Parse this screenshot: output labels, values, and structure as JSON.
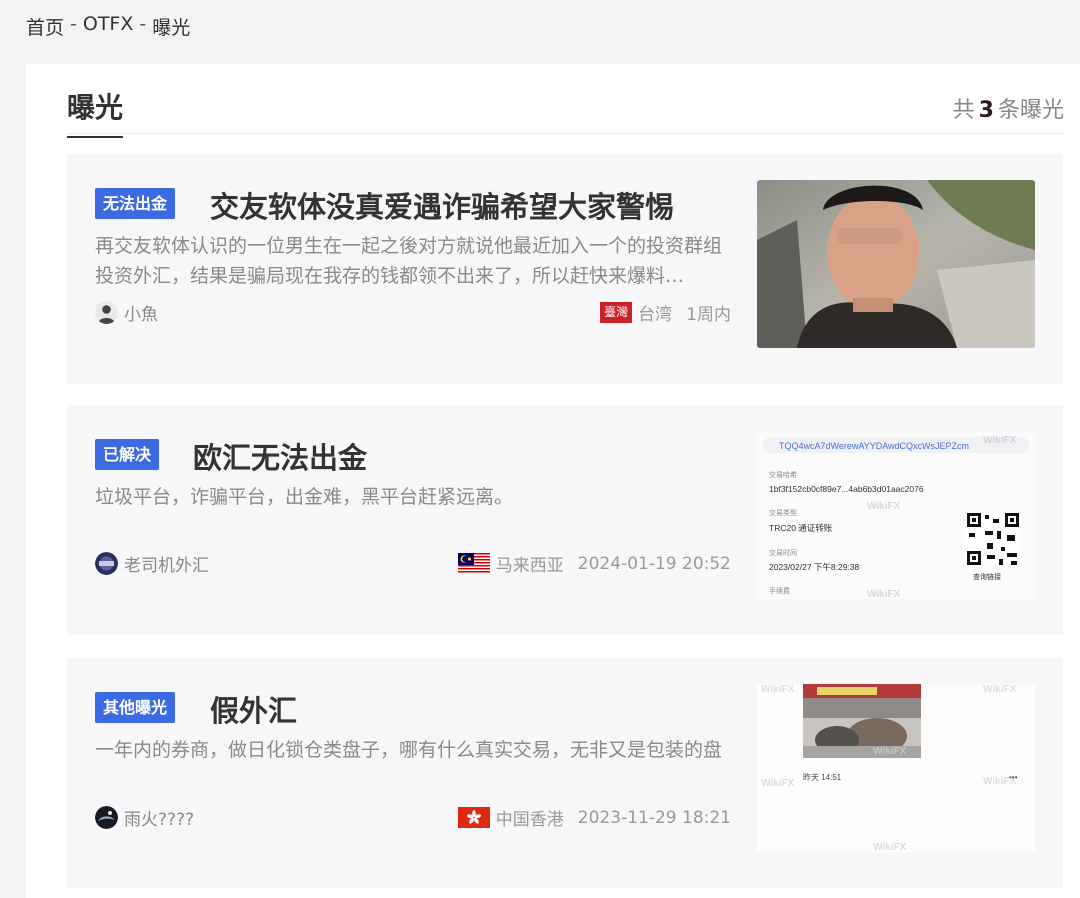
{
  "breadcrumb": {
    "home": "首页",
    "broker": "OTFX",
    "current": "曝光",
    "separator": "-"
  },
  "header": {
    "title": "曝光",
    "count_prefix": "共",
    "count": "3",
    "count_suffix": "条曝光"
  },
  "cards": [
    {
      "tag": "无法出金",
      "title": "交友软体没真爱遇诈骗希望大家警惕",
      "description": "再交友软体认识的一位男生在一起之後对方就说他最近加入一个的投资群组投资外汇，结果是骗局现在我存的钱都领不出来了，所以赶快来爆料…",
      "author": "小魚",
      "region_badge": "臺灣",
      "region": "台湾",
      "time": "1周内"
    },
    {
      "tag": "已解决",
      "title": "欧汇无法出金",
      "description": "垃圾平台，诈骗平台，出金难，黑平台赶紧远离。",
      "author": "老司机外汇",
      "region": "马来西亚",
      "time": "2024-01-19 20:52",
      "thumb_text": {
        "address": "TQQ4wcA7dWerewAYYDAwdCQxcWsJEPZcm",
        "hash_label": "交易哈希",
        "hash_value": "1bf3f152cb0cf89e7...4ab6b3d01aac2076",
        "type_label": "交易类型",
        "type_value": "TRC20 通证转账",
        "time_label": "交易时间",
        "time_value": "2023/02/27 下午8:29:38",
        "fee_label": "手续费",
        "qr_caption": "查询链接",
        "watermark": "WikiFX"
      }
    },
    {
      "tag": "其他曝光",
      "title": "假外汇",
      "description": "一年内的券商，做日化锁仓类盘子，哪有什么真实交易，无非又是包装的盘",
      "author": "雨火????",
      "region": "中国香港",
      "time": "2023-11-29 18:21",
      "thumb_text": {
        "caption": "昨天 14:51",
        "watermark": "WikiFX"
      }
    }
  ],
  "colors": {
    "tag_bg": "#3c6ae0",
    "card_bg": "#f7f7f9",
    "tw_badge": "#c8222a",
    "hk_flag": "#de2910"
  }
}
